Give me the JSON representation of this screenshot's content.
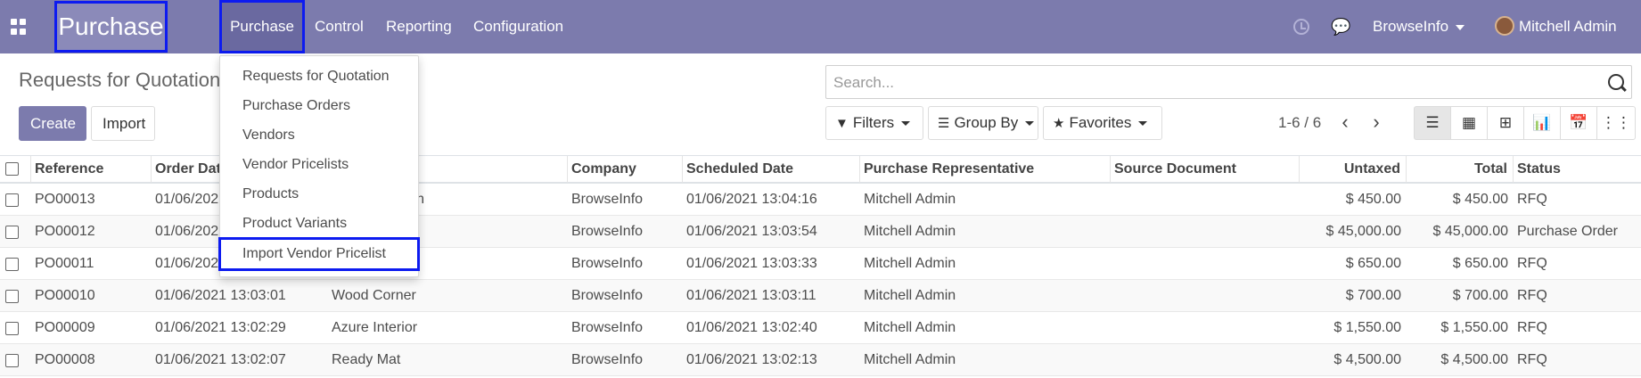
{
  "navbar": {
    "app_name": "Purchase",
    "menus": [
      "Purchase",
      "Control",
      "Reporting",
      "Configuration"
    ],
    "company": "BrowseInfo",
    "user": "Mitchell Admin"
  },
  "control_panel": {
    "title": "Requests for Quotation",
    "create_label": "Create",
    "import_label": "Import",
    "search_placeholder": "Search...",
    "filters_label": "Filters",
    "groupby_label": "Group By",
    "favorites_label": "Favorites",
    "pager": "1-6 / 6",
    "pager_prev": "‹",
    "pager_next": "›"
  },
  "dropdown": {
    "items": [
      "Requests for Quotation",
      "Purchase Orders",
      "Vendors",
      "Vendor Pricelists",
      "Products",
      "Product Variants",
      "Import Vendor Pricelist"
    ]
  },
  "table": {
    "headers": {
      "reference": "Reference",
      "order_date": "Order Date",
      "company": "Company",
      "scheduled_date": "Scheduled Date",
      "representative": "Purchase Representative",
      "source": "Source Document",
      "untaxed": "Untaxed",
      "total": "Total",
      "status": "Status"
    },
    "rows": [
      {
        "ref": "PO00013",
        "order_date": "01/06/2021 13:04:16",
        "vendor": "Addison Olson",
        "company": "BrowseInfo",
        "scheduled": "01/06/2021 13:04:16",
        "rep": "Mitchell Admin",
        "untaxed": "$ 450.00",
        "total": "$ 450.00",
        "status": "RFQ"
      },
      {
        "ref": "PO00012",
        "order_date": "01/06/2021 13:03:54",
        "vendor": "ture",
        "company": "BrowseInfo",
        "scheduled": "01/06/2021 13:03:54",
        "rep": "Mitchell Admin",
        "untaxed": "$ 45,000.00",
        "total": "$ 45,000.00",
        "status": "Purchase Order"
      },
      {
        "ref": "PO00011",
        "order_date": "01/06/2021 13:03:33",
        "vendor": "ture",
        "company": "BrowseInfo",
        "scheduled": "01/06/2021 13:03:33",
        "rep": "Mitchell Admin",
        "untaxed": "$ 650.00",
        "total": "$ 650.00",
        "status": "RFQ"
      },
      {
        "ref": "PO00010",
        "order_date": "01/06/2021 13:03:01",
        "vendor": "Wood Corner",
        "company": "BrowseInfo",
        "scheduled": "01/06/2021 13:03:11",
        "rep": "Mitchell Admin",
        "untaxed": "$ 700.00",
        "total": "$ 700.00",
        "status": "RFQ"
      },
      {
        "ref": "PO00009",
        "order_date": "01/06/2021 13:02:29",
        "vendor": "Azure Interior",
        "company": "BrowseInfo",
        "scheduled": "01/06/2021 13:02:40",
        "rep": "Mitchell Admin",
        "untaxed": "$ 1,550.00",
        "total": "$ 1,550.00",
        "status": "RFQ"
      },
      {
        "ref": "PO00008",
        "order_date": "01/06/2021 13:02:07",
        "vendor": "Ready Mat",
        "company": "BrowseInfo",
        "scheduled": "01/06/2021 13:02:13",
        "rep": "Mitchell Admin",
        "untaxed": "$ 4,500.00",
        "total": "$ 4,500.00",
        "status": "RFQ"
      }
    ]
  },
  "colors": {
    "navbar": "#7c7bad",
    "highlight_border": "#0d1bf0"
  }
}
